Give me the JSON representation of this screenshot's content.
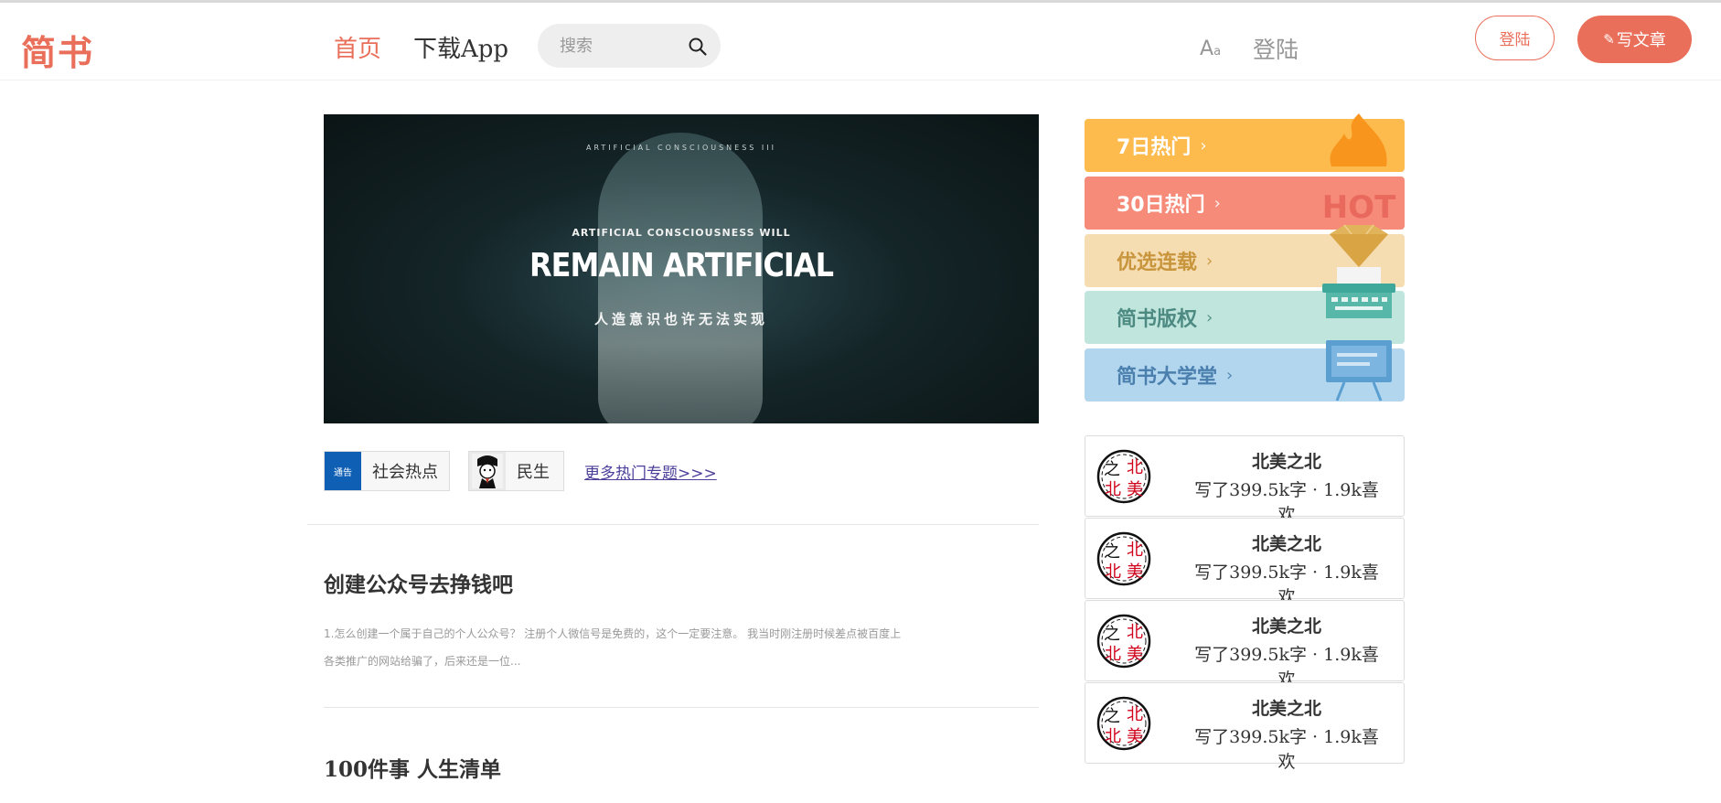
{
  "header": {
    "logo": "简书",
    "nav_home": "首页",
    "nav_app": "下载App",
    "search_placeholder": "搜索",
    "aa_main": "A",
    "aa_small": "a",
    "login_link": "登陆",
    "login_button": "登陆",
    "write_button": "写文章",
    "accent_color": "#ea6f5a"
  },
  "banner": {
    "small_caption": "ARTIFICIAL CONSCIOUSNESS III",
    "line1": "ARTIFICIAL CONSCIOUSNESS WILL",
    "line2": "REMAIN ARTIFICIAL",
    "line3": "人造意识也许无法实现"
  },
  "topics": {
    "items": [
      {
        "label": "社会热点",
        "thumb_text": "通告"
      },
      {
        "label": "民生",
        "thumb_text": ""
      }
    ],
    "more_link": "更多热门专题>>>"
  },
  "articles": [
    {
      "title": "创建公众号去挣钱吧",
      "excerpt": "1.怎么创建一个属于自己的个人公众号？ 注册个人微信号是免费的，这个一定要注意。 我当时刚注册时候差点被百度上各类推广的网站给骗了，后来还是一位..."
    },
    {
      "title": "100件事 人生清单",
      "excerpt": ""
    }
  ],
  "boards": [
    {
      "label": "7日热门",
      "chevron": "›",
      "color": "#fdbb4e"
    },
    {
      "label": "30日热门",
      "chevron": "›",
      "color": "#f78b7a"
    },
    {
      "label": "优选连载",
      "chevron": "›",
      "color": "#f5dcb1"
    },
    {
      "label": "简书版权",
      "chevron": "›",
      "color": "#bfe5dd"
    },
    {
      "label": "简书大学堂",
      "chevron": "›",
      "color": "#b3d6ef"
    }
  ],
  "board_art_text": "HOT",
  "authors": [
    {
      "name": "北美之北",
      "stats": "写了399.5k字 · 1.9k喜欢",
      "avatar_chars": [
        "之",
        "北",
        "北",
        "美"
      ]
    },
    {
      "name": "北美之北",
      "stats": "写了399.5k字 · 1.9k喜欢",
      "avatar_chars": [
        "之",
        "北",
        "北",
        "美"
      ]
    },
    {
      "name": "北美之北",
      "stats": "写了399.5k字 · 1.9k喜欢",
      "avatar_chars": [
        "之",
        "北",
        "北",
        "美"
      ]
    },
    {
      "name": "北美之北",
      "stats": "写了399.5k字 · 1.9k喜欢",
      "avatar_chars": [
        "之",
        "北",
        "北",
        "美"
      ]
    }
  ]
}
